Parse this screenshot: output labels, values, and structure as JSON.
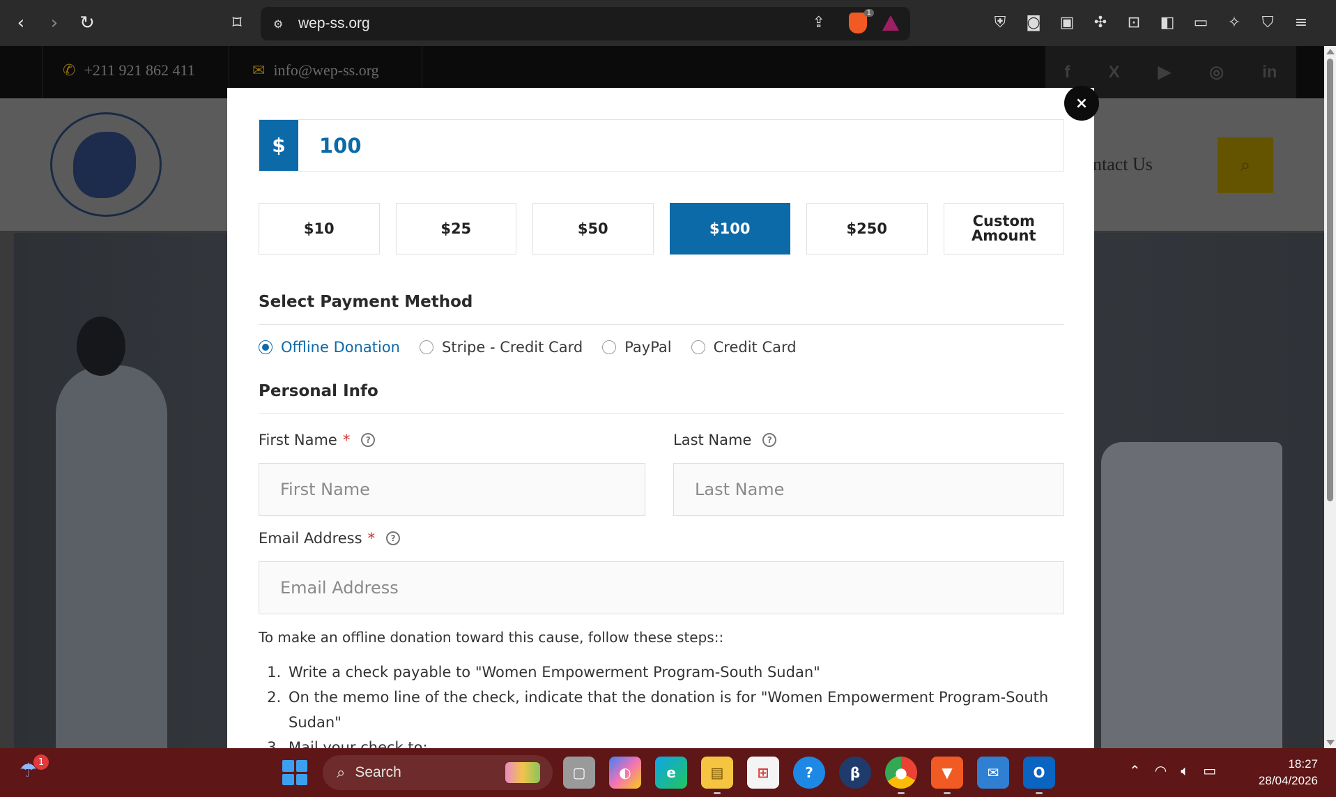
{
  "browser": {
    "url": "wep-ss.org",
    "shield_badge": "1",
    "icons": [
      "back-icon",
      "forward-icon",
      "reload-icon",
      "bookmark-icon",
      "site-settings-icon",
      "share-icon",
      "brave-shield-icon",
      "bat-rewards-icon",
      "vpn-icon",
      "camera-icon",
      "extension-icon",
      "puzzle-icon",
      "reader-icon",
      "sidebar-icon",
      "wallet-icon",
      "leo-ai-icon",
      "firewall-icon",
      "menu-icon"
    ]
  },
  "site": {
    "phone": "+211 921 862 411",
    "email": "info@wep-ss.org",
    "nav_contact": "ontact Us",
    "social": [
      "f",
      "X",
      "▶",
      "◎",
      "in"
    ]
  },
  "modal": {
    "close_label": "×",
    "currency_symbol": "$",
    "amount": "100",
    "levels": [
      "$10",
      "$25",
      "$50",
      "$100",
      "$250",
      "Custom Amount"
    ],
    "selected_level": "$100",
    "payment_title": "Select Payment Method",
    "methods": [
      "Offline Donation",
      "Stripe - Credit Card",
      "PayPal",
      "Credit Card"
    ],
    "selected_method": "Offline Donation",
    "personal_title": "Personal Info",
    "first_name_label": "First Name",
    "first_name_placeholder": "First Name",
    "last_name_label": "Last Name",
    "last_name_placeholder": "Last Name",
    "email_label": "Email Address",
    "email_placeholder": "Email Address",
    "required_mark": "*",
    "help_mark": "?",
    "instructions": "To make an offline donation toward this cause, follow these steps::",
    "steps": [
      "Write a check payable to \"Women Empowerment Program-South Sudan\"",
      "On the memo line of the check, indicate that the donation is for \"Women Empowerment Program-South Sudan\"",
      "Mail your check to:"
    ]
  },
  "taskbar": {
    "weather_badge": "1",
    "search_label": "Search",
    "time": "18:27",
    "date": "28/04/2026",
    "apps": [
      "task-view",
      "copilot",
      "edge",
      "file-explorer",
      "microsoft-store",
      "get-help",
      "beta-app",
      "chrome",
      "brave",
      "outlook-new",
      "outlook"
    ]
  },
  "colors": {
    "accent": "#0d6aa8",
    "required": "#d0312d",
    "taskbar": "#5e1616"
  }
}
